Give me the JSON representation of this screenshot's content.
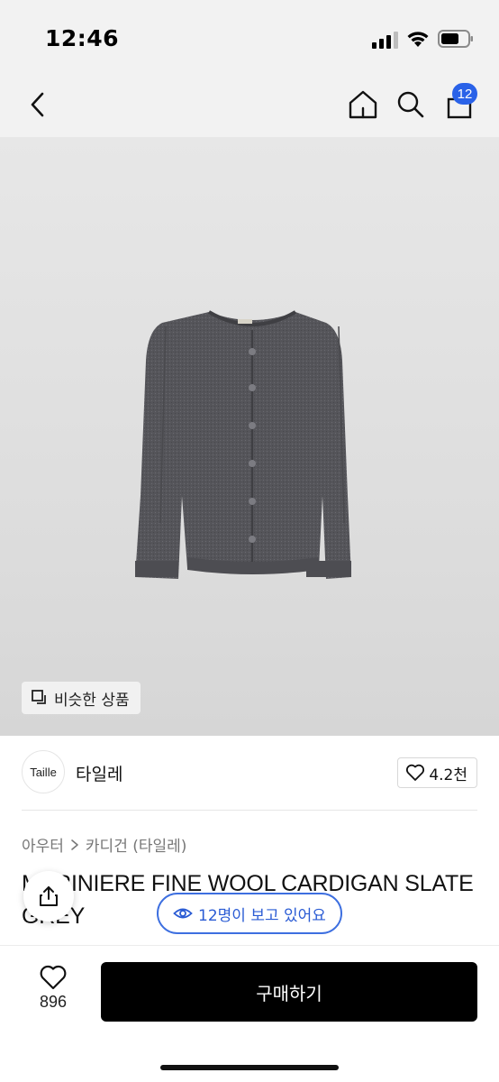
{
  "status_bar": {
    "time": "12:46"
  },
  "nav": {
    "cart_count": "12"
  },
  "hero": {
    "similar_label": "비슷한 상품"
  },
  "seller": {
    "logo_text": "Taille",
    "name": "타일레",
    "likes": "4.2천"
  },
  "breadcrumb": {
    "category": "아우터",
    "subcategory": "카디건 (타일레)"
  },
  "product": {
    "title": "MARINIERE FINE WOOL CARDIGAN SLATE GREY"
  },
  "viewers": {
    "label": "12명이 보고 있어요"
  },
  "bottom": {
    "wish_count": "896",
    "buy_label": "구매하기"
  },
  "colors": {
    "accent": "#2a62e8",
    "buy_button": "#000000",
    "cardigan": "#55555a"
  }
}
